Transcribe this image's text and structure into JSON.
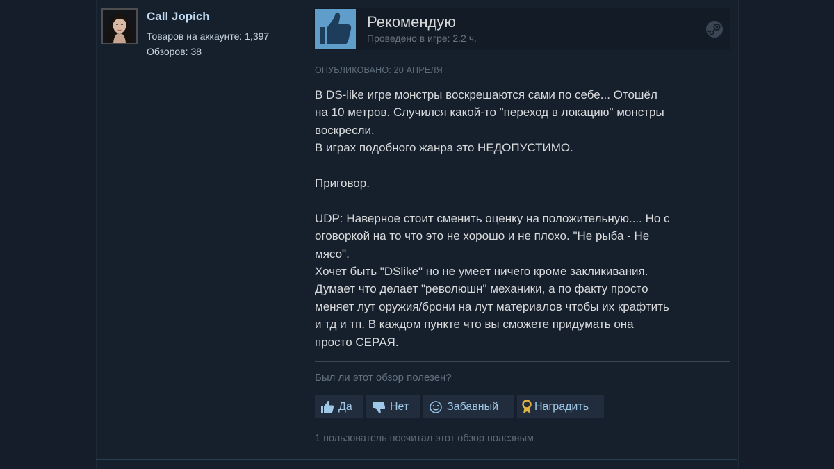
{
  "author": {
    "name": "Call Jopich",
    "products": "Товаров на аккаунте: 1,397",
    "reviews": "Обзоров: 38"
  },
  "vote": {
    "title": "Рекомендую",
    "playtime": "Проведено в игре: 2.2 ч."
  },
  "posted": "Опубликовано: 20 апреля",
  "review_paragraphs": [
    "В DS-like игре монстры воскрешаются сами по себе... Отошёл\nна 10 метров. Случился какой-то \"переход в локацию\" монстры\nвоскресли.\nВ играх подобного жанра это НЕДОПУСТИМО.",
    "Приговор.",
    "UDP: Наверное стоит сменить оценку на положительную.... Но с\nоговоркой на то что это не хорошо и не плохо. \"Не рыба - Не\nмясо\".\nХочет быть \"DSlike\" но не умеет ничего кроме закликивания.\nДумает что делает \"революшн\" механики, а по факту просто\nменяет лут оружия/брони на лут материалов чтобы их крафтить\nи тд и тп. В каждом пункте что вы сможете придумать она\nпросто СЕРАЯ."
  ],
  "helpful_question": "Был ли этот обзор полезен?",
  "buttons": {
    "yes": "Да",
    "no": "Нет",
    "funny": "Забавный",
    "award": "Наградить"
  },
  "found_helpful": "1 пользователь посчитал этот обзор полезным",
  "icons": [
    "thumbs-up-icon",
    "steam-icon",
    "thumbs-down-icon",
    "smiley-icon",
    "award-icon"
  ],
  "colors": {
    "thumb_accent": "#5f9dcb",
    "button_text": "#9fc7e8",
    "award_gold": "#e3b341"
  }
}
